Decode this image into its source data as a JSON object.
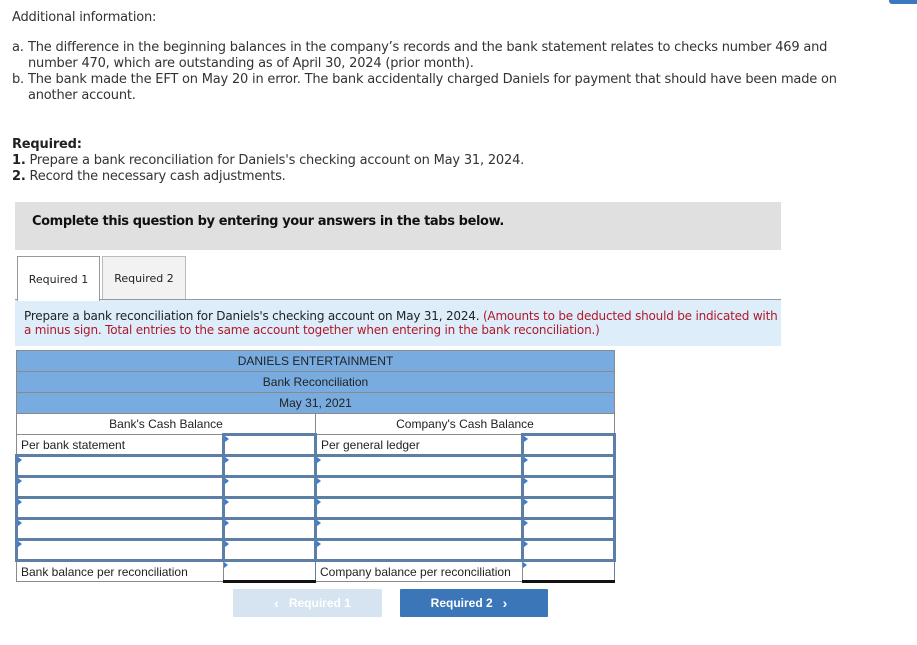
{
  "additional_info": {
    "title": "Additional information:",
    "items": [
      {
        "marker": "a.",
        "text": "The difference in the beginning balances in the company’s records and the bank statement relates to checks number 469 and number 470, which are outstanding as of April 30, 2024 (prior month)."
      },
      {
        "marker": "b.",
        "text": "The bank made the EFT on May 20 in error. The bank accidentally charged Daniels for payment that should have been made on another account."
      }
    ]
  },
  "required": {
    "heading": "Required:",
    "items": [
      {
        "num": "1.",
        "text": " Prepare a bank reconciliation for Daniels's checking account on May 31, 2024."
      },
      {
        "num": "2.",
        "text": " Record the necessary cash adjustments."
      }
    ]
  },
  "instruction_box": "Complete this question by entering your answers in the tabs below.",
  "tabs": [
    {
      "label": "Required 1",
      "active": true
    },
    {
      "label": "Required 2",
      "active": false
    }
  ],
  "prompt": {
    "main": "Prepare a bank reconciliation for Daniels's checking account on May 31, 2024.",
    "note": "(Amounts to be deducted should be indicated with a minus sign. Total entries to the same account together when entering in the bank reconciliation.)"
  },
  "reconciliation": {
    "company": "DANIELS ENTERTAINMENT",
    "title": "Bank Reconciliation",
    "date": "May 31, 2021",
    "bank_header": "Bank's Cash Balance",
    "company_header": "Company's Cash Balance",
    "bank_first_label": "Per bank statement",
    "company_first_label": "Per general ledger",
    "bank_total_label": "Bank balance per reconciliation",
    "company_total_label": "Company balance per reconciliation",
    "bank_first_value": "",
    "company_first_value": "",
    "bank_total_value": "",
    "company_total_value": "",
    "rows": [
      {
        "bank_label": "",
        "bank_amount": "",
        "company_label": "",
        "company_amount": ""
      },
      {
        "bank_label": "",
        "bank_amount": "",
        "company_label": "",
        "company_amount": ""
      },
      {
        "bank_label": "",
        "bank_amount": "",
        "company_label": "",
        "company_amount": ""
      },
      {
        "bank_label": "",
        "bank_amount": "",
        "company_label": "",
        "company_amount": ""
      },
      {
        "bank_label": "",
        "bank_amount": "",
        "company_label": "",
        "company_amount": ""
      }
    ]
  },
  "nav": {
    "prev_label": "Required 1",
    "next_label": "Required 2",
    "prev_icon": "chevron-left-icon",
    "next_icon": "chevron-right-icon",
    "prev_chevron": "‹",
    "next_chevron": "›"
  }
}
